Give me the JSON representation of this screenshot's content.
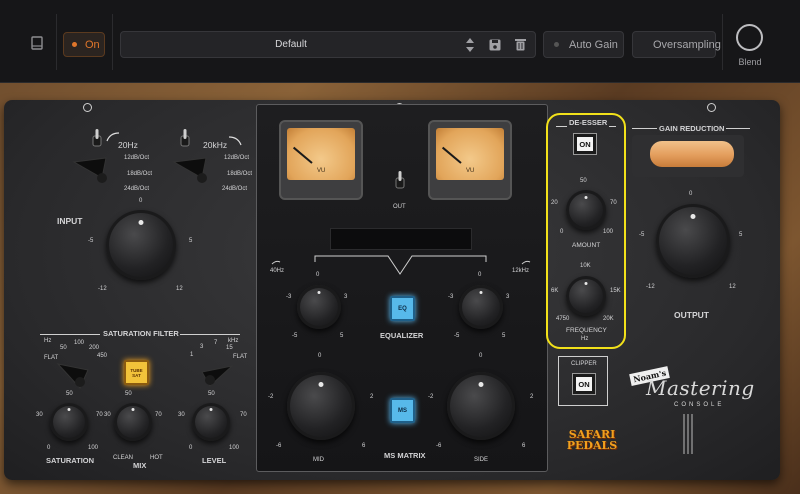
{
  "topbar": {
    "power_label": "On",
    "preset_name": "Default",
    "auto_gain_label": "Auto Gain",
    "oversampling_label": "Oversampling",
    "blend_label": "Blend",
    "colors": {
      "accent": "#e0762b",
      "bar_bg": "#161618"
    }
  },
  "left": {
    "hp_freq": "20Hz",
    "lp_freq": "20kHz",
    "slopes": [
      "12dB/Oct",
      "18dB/Oct",
      "24dB/Oct"
    ],
    "input_label": "INPUT",
    "input_scale": {
      "top": "0",
      "left": "-5",
      "right": "5",
      "bl": "-12",
      "br": "12"
    },
    "sat_filter_title": "SATURATION FILTER",
    "sat_hz_unit": "Hz",
    "sat_khz_unit": "kHz",
    "sat_hz_scale": [
      "FLAT",
      "50",
      "100",
      "200",
      "450"
    ],
    "sat_khz_scale": [
      "1",
      "3",
      "7",
      "15",
      "FLAT"
    ],
    "tube_label": "TUBE SAT",
    "saturation_label": "SATURATION",
    "mix_label": "MIX",
    "clean_label": "CLEAN",
    "hot_label": "HOT",
    "level_label": "LEVEL",
    "knob_scale": {
      "top": "50",
      "left": "30",
      "right": "70",
      "bl": "0",
      "br": "100"
    }
  },
  "center": {
    "meter_label": "VU",
    "out_label": "OUT",
    "eq_low": "40Hz",
    "eq_high": "12kHz",
    "eq_label": "EQUALIZER",
    "eq_btn": "EQ",
    "ms_btn": "MS",
    "ms_label": "MS MATRIX",
    "mid_label": "MID",
    "side_label": "SIDE",
    "small_scale": {
      "top": "0",
      "left": "-3",
      "right": "3",
      "bl": "-5",
      "br": "5"
    },
    "big_scale": {
      "top": "0",
      "left": "-2",
      "right": "2",
      "bl": "-6",
      "br": "6"
    }
  },
  "deesser": {
    "title": "DE-ESSER",
    "on_label": "ON",
    "amount_label": "AMOUNT",
    "amount_scale": {
      "top": "50",
      "left": "20",
      "right": "70",
      "bl": "0",
      "br": "100"
    },
    "freq_label": "FREQUENCY",
    "freq_unit": "Hz",
    "freq_scale": {
      "top": "10K",
      "left": "6K",
      "right": "15K",
      "bl": "4750",
      "br": "20K"
    },
    "highlight_color": "#f2e11a"
  },
  "right": {
    "gr_label": "GAIN REDUCTION",
    "output_label": "OUTPUT",
    "output_scale": {
      "top": "0",
      "left": "-5",
      "right": "5",
      "bl": "-12",
      "br": "12"
    },
    "clipper_label": "CLIPPER",
    "clipper_on": "ON",
    "brand_small": "Noam's",
    "brand_big": "Mastering",
    "brand_sub": "CONSOLE",
    "maker_line1": "SAFARI",
    "maker_line2": "PEDALS"
  }
}
